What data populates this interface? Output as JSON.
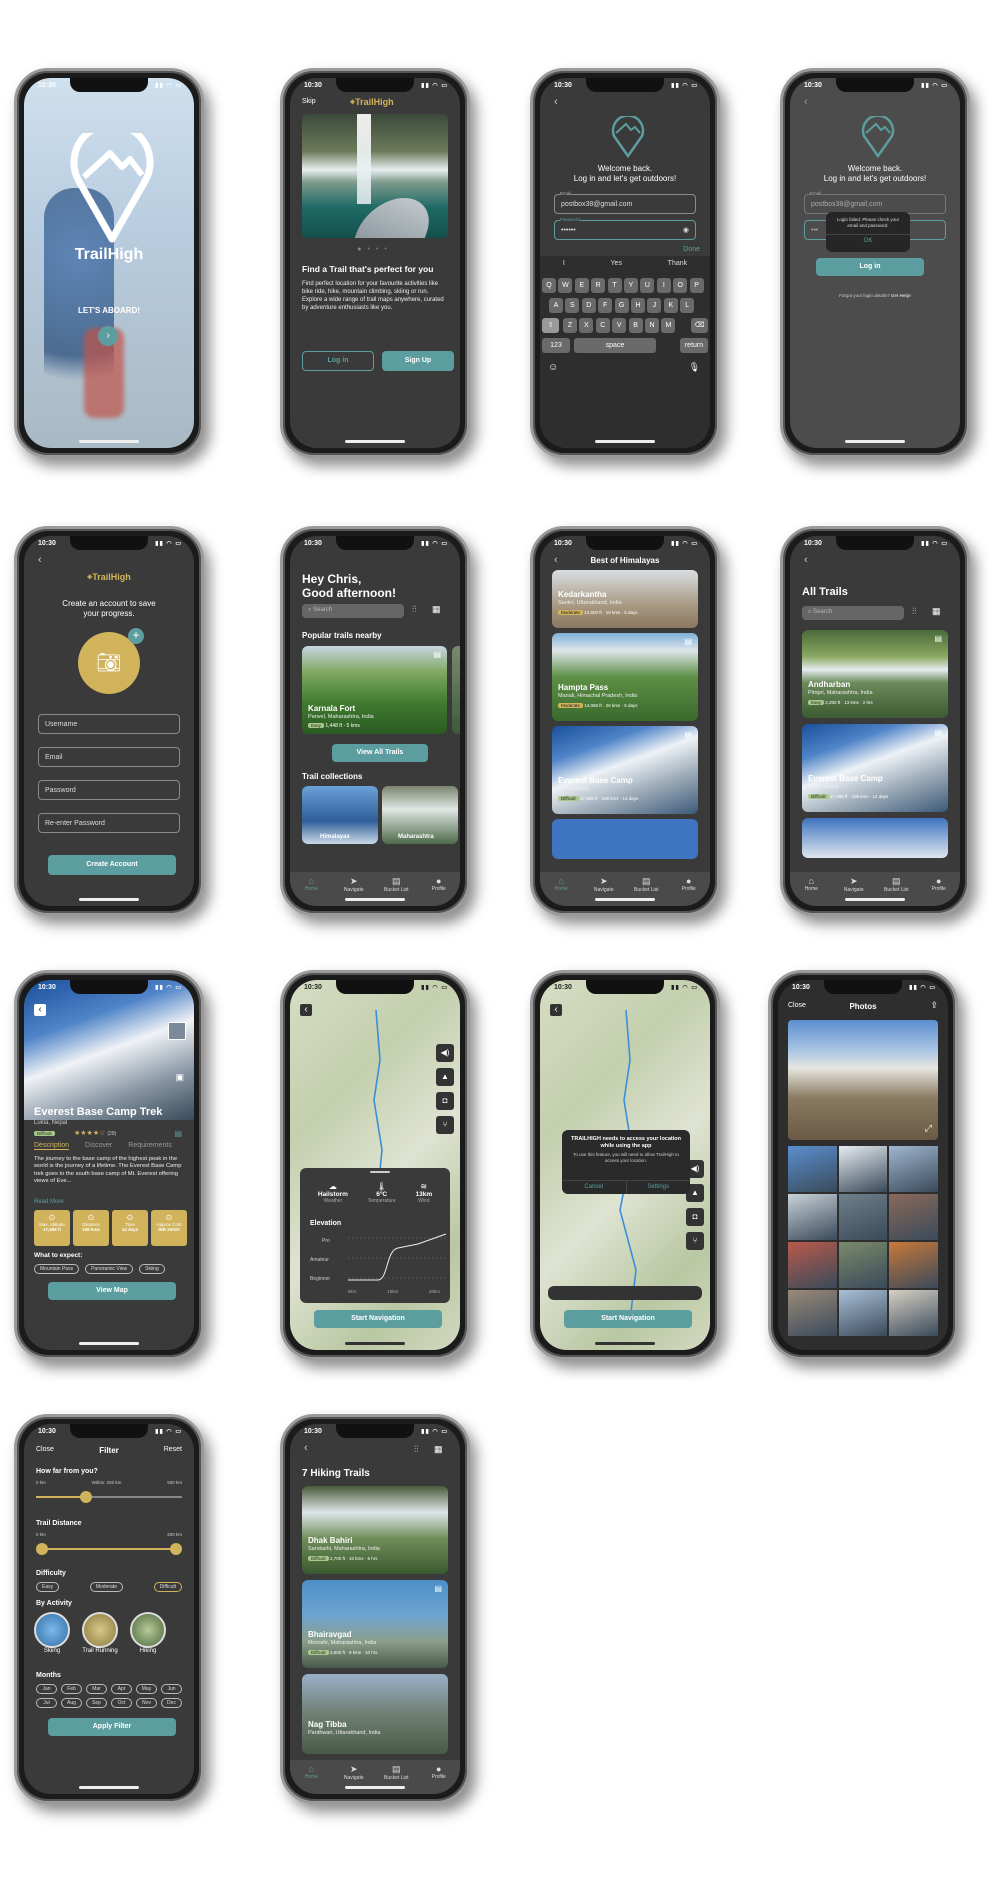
{
  "status_time": "10:30",
  "app_name": "TrailHigh",
  "s1": {
    "tagline": "LET'S ABOARD!"
  },
  "s2": {
    "skip": "Skip",
    "title": "Find a Trail that's perfect for you",
    "body": "Find perfect location for your favourite activities like bike ride, hike, mountain climbing, skiing or run.  Explore a wide range of trail maps anywhere, curated by adventure enthusiasts like you.",
    "login": "Log in",
    "signup": "Sign Up"
  },
  "s3": {
    "welcome": "Welcome back.",
    "sub": "Log in and let's get outdoors!",
    "email_label": "Email",
    "email": "postbox38@gmail.com",
    "password_label": "Password",
    "password": "••••••",
    "done": "Done",
    "suggest": [
      "I",
      "Yes",
      "Thank"
    ],
    "row1": [
      "Q",
      "W",
      "E",
      "R",
      "T",
      "Y",
      "U",
      "I",
      "O",
      "P"
    ],
    "row2": [
      "A",
      "S",
      "D",
      "F",
      "G",
      "H",
      "J",
      "K",
      "L"
    ],
    "row3": [
      "Z",
      "X",
      "C",
      "V",
      "B",
      "N",
      "M"
    ],
    "k123": "123",
    "space": "space",
    "ret": "return"
  },
  "s4": {
    "welcome": "Welcome back.",
    "sub": "Log in and let's get outdoors!",
    "email_label": "Email",
    "email": "postbox38@gmail.com",
    "alert": "Login failed. Please check your email and password.",
    "ok": "OK",
    "login": "Log in",
    "forgot": "Forgot your login details?",
    "help": "Get Help!"
  },
  "s5": {
    "title": "Create an account to save your progress.",
    "username": "Username",
    "email": "Email",
    "password": "Password",
    "repassword": "Re-enter Password",
    "create": "Create Account"
  },
  "s6": {
    "greet": "Hey Chris,",
    "greet2": "Good afternoon!",
    "search": "Search",
    "popular": "Popular trails nearby",
    "card": {
      "name": "Karnala Fort",
      "loc": "Panvel, Maharashtra, India",
      "tag": "Easy",
      "stats": "1,448 ft  ·  5 kms"
    },
    "view_all": "View All Trails",
    "collections": "Trail collections",
    "coll": [
      "Himalayas",
      "Maharashtra"
    ]
  },
  "tabs": [
    "Home",
    "Navigate",
    "Bucket List",
    "Profile"
  ],
  "s7": {
    "title": "Best of Himalayas",
    "cards": [
      {
        "name": "Kedarkantha",
        "loc": "Sankri, Uttarakhand, India",
        "tag": "Moderate",
        "stats": "12,500 ft  ·  18 kms  ·  5 days"
      },
      {
        "name": "Hampta Pass",
        "loc": "Manali, Himachal Pradesh, India",
        "tag": "Moderate",
        "stats": "14,065 ft  ·  26 kms  ·  5 days"
      },
      {
        "name": "Everest Base Camp",
        "loc": "Lukla, Nepal",
        "tag": "Difficult",
        "stats": "17,598 ft  ·  108 kms  ·  14 days"
      }
    ]
  },
  "s8": {
    "title": "All Trails",
    "search": "Search",
    "cards": [
      {
        "name": "Andharban",
        "loc": "Pimpri, Maharashtra, India",
        "tag": "Easy",
        "stats": "2,200 ft  ·  13 kms  ·  2 hrs"
      },
      {
        "name": "Everest Base Camp",
        "loc": "Lukla, Nepal",
        "tag": "Difficult",
        "stats": "17,598 ft  ·  108 kms  ·  14 days"
      }
    ]
  },
  "s9": {
    "title": "Everest Base Camp Trek",
    "loc": "Lukla, Nepal",
    "tag": "Difficult",
    "rating": "(29)",
    "tabs": [
      "Description",
      "Discover",
      "Requirements"
    ],
    "desc": "The journey to the base camp of the highest peak in the world is the journey of a lifetime. The Everest Base Camp trek goes to the south base camp of Mt. Everest offering views of Eve...",
    "read_more": "Read More",
    "stats": [
      {
        "l": "Max. Altitude",
        "v": "17,598 ft"
      },
      {
        "l": "Distance",
        "v": "108 kms"
      },
      {
        "l": "Time",
        "v": "14 days"
      },
      {
        "l": "Approx Cost",
        "v": "INR 20000"
      }
    ],
    "expect": "What to expect:",
    "chips": [
      "Mountain Pass",
      "Panoramic View",
      "Skiing"
    ],
    "view_map": "View Map"
  },
  "s10": {
    "weather": [
      {
        "v": "Hailstorm",
        "l": "Weather"
      },
      {
        "v": "6°C",
        "l": "Temperature"
      },
      {
        "v": "13km",
        "l": "Wind"
      }
    ],
    "elevation": "Elevation",
    "levels": [
      "Pro",
      "Amateur",
      "Beginner"
    ],
    "xt": [
      "5km",
      "10km",
      "20km"
    ],
    "start": "Start Navigation"
  },
  "s11": {
    "alert_title": "TRAILHIGH needs to access your location while using the app",
    "alert_body": "To use this feature, you will need to allow TrailHigh to access your location.",
    "cancel": "Cancel",
    "settings": "Settings",
    "start": "Start Navigation"
  },
  "s12": {
    "close": "Close",
    "title": "Photos"
  },
  "s13": {
    "close": "Close",
    "title": "Filter",
    "reset": "Reset",
    "q1": "How far from you?",
    "r1": [
      "0 km",
      "Within: 250 km",
      "500 km"
    ],
    "q2": "Trail Distance",
    "r2": [
      "0 km",
      "200 km"
    ],
    "q3": "Difficulty",
    "diff": [
      "Easy",
      "Moderate",
      "Difficult"
    ],
    "q4": "By Activity",
    "acts": [
      "Skiing",
      "Trail Running",
      "Hiking"
    ],
    "q5": "Months",
    "months": [
      "Jan",
      "Feb",
      "Mar",
      "Apr",
      "May",
      "Jun",
      "Jul",
      "Aug",
      "Sep",
      "Oct",
      "Nov",
      "Dec"
    ],
    "apply": "Apply Filter"
  },
  "s14": {
    "title": "7 Hiking Trails",
    "cards": [
      {
        "name": "Dhak Bahiri",
        "loc": "Sandashi, Maharashtra, India",
        "tag": "Difficult",
        "stats": "2,700 ft  ·  10 kms  ·  6 hrs"
      },
      {
        "name": "Bhairavgad",
        "loc": "Moroshi, Maharashtra, India",
        "tag": "Difficult",
        "stats": "3,600 ft  ·  9 kms  ·  10 hrs"
      },
      {
        "name": "Nag Tibba",
        "loc": "Panthwari, Uttarakhand, India",
        "tag": "",
        "stats": ""
      }
    ]
  }
}
